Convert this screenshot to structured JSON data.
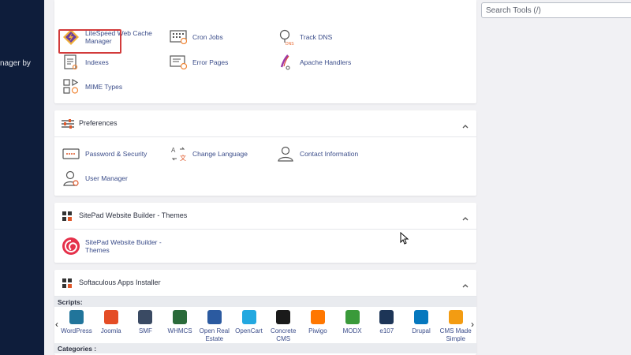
{
  "sidebar": {
    "text": "nager by"
  },
  "search": {
    "placeholder": "Search Tools (/)"
  },
  "advanced": {
    "items": [
      {
        "label": "LiteSpeed Web Cache Manager",
        "icon": "litespeed-icon"
      },
      {
        "label": "Cron Jobs",
        "icon": "calendar-icon"
      },
      {
        "label": "Track DNS",
        "icon": "track-dns-icon"
      },
      {
        "label": "Indexes",
        "icon": "indexes-icon"
      },
      {
        "label": "Error Pages",
        "icon": "error-pages-icon"
      },
      {
        "label": "Apache Handlers",
        "icon": "apache-handlers-icon"
      },
      {
        "label": "MIME Types",
        "icon": "mime-types-icon"
      }
    ]
  },
  "preferences": {
    "title": "Preferences",
    "items": [
      {
        "label": "Password & Security"
      },
      {
        "label": "Change Language"
      },
      {
        "label": "Contact Information"
      },
      {
        "label": "User Manager"
      }
    ]
  },
  "sitepad": {
    "title": "SitePad Website Builder - Themes",
    "items": [
      {
        "label": "SitePad Website Builder - Themes"
      }
    ]
  },
  "softaculous": {
    "title": "Softaculous Apps Installer",
    "scripts_label": "Scripts:",
    "categories_label": "Categories :",
    "apps": [
      {
        "label": "WordPress",
        "color": "#21759b"
      },
      {
        "label": "Joomla",
        "color": "#e44d26"
      },
      {
        "label": "SMF",
        "color": "#3a4a63"
      },
      {
        "label": "WHMCS",
        "color": "#2a6a3a"
      },
      {
        "label": "Open Real Estate",
        "color": "#2b5aa0"
      },
      {
        "label": "OpenCart",
        "color": "#23a8e0"
      },
      {
        "label": "Concrete CMS",
        "color": "#1a1a1a"
      },
      {
        "label": "Piwigo",
        "color": "#ff7700"
      },
      {
        "label": "MODX",
        "color": "#3a9a3a"
      },
      {
        "label": "e107",
        "color": "#1d3557"
      },
      {
        "label": "Drupal",
        "color": "#0678be"
      },
      {
        "label": "CMS Made Simple",
        "color": "#f39c12"
      }
    ]
  },
  "colors": {
    "sidebar": "#0e1d3b",
    "link": "#3b4d8a",
    "highlight": "#d23b3b"
  }
}
